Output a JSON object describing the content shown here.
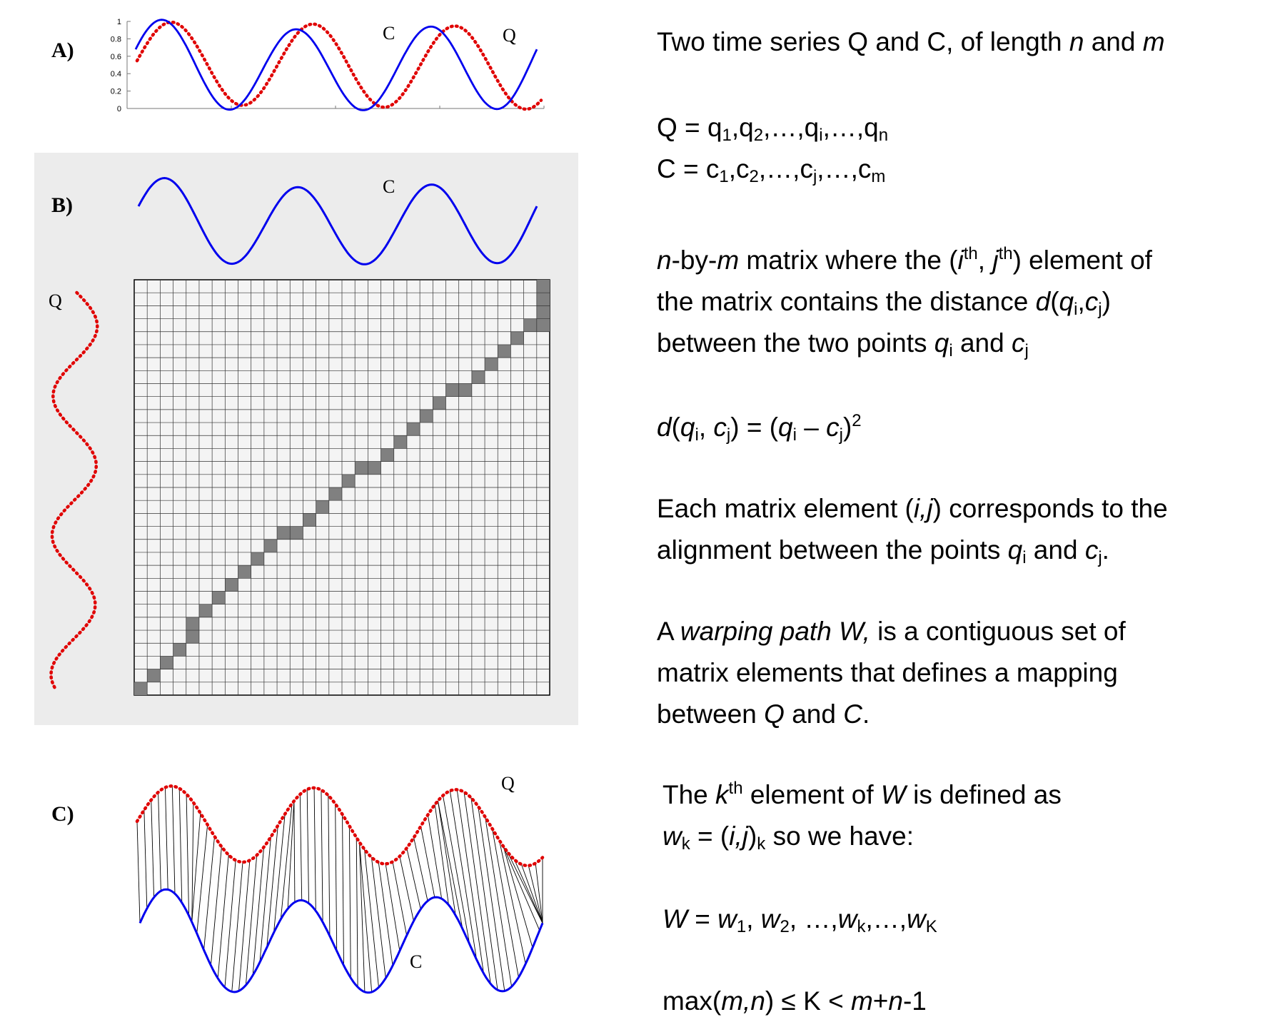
{
  "panels": {
    "a": {
      "label": "A)",
      "series_c_label": "C",
      "series_q_label": "Q",
      "y_ticks": [
        "1",
        "0.8",
        "0.6",
        "0.4",
        "0.2",
        "0"
      ]
    },
    "b": {
      "label": "B)",
      "series_c_label": "C",
      "series_q_label": "Q",
      "grid_size": 32,
      "warping_path": [
        [
          0,
          0
        ],
        [
          1,
          1
        ],
        [
          2,
          2
        ],
        [
          3,
          3
        ],
        [
          4,
          4
        ],
        [
          4,
          5
        ],
        [
          5,
          6
        ],
        [
          6,
          7
        ],
        [
          7,
          8
        ],
        [
          8,
          9
        ],
        [
          9,
          10
        ],
        [
          10,
          11
        ],
        [
          11,
          12
        ],
        [
          12,
          12
        ],
        [
          13,
          13
        ],
        [
          14,
          14
        ],
        [
          15,
          15
        ],
        [
          16,
          16
        ],
        [
          17,
          17
        ],
        [
          18,
          17
        ],
        [
          19,
          18
        ],
        [
          20,
          19
        ],
        [
          21,
          20
        ],
        [
          22,
          21
        ],
        [
          23,
          22
        ],
        [
          24,
          23
        ],
        [
          25,
          23
        ],
        [
          26,
          24
        ],
        [
          27,
          25
        ],
        [
          28,
          26
        ],
        [
          29,
          27
        ],
        [
          30,
          28
        ],
        [
          31,
          28
        ],
        [
          31,
          29
        ],
        [
          31,
          30
        ],
        [
          31,
          31
        ]
      ]
    },
    "c": {
      "label": "C)",
      "series_c_label": "C",
      "series_q_label": "Q"
    }
  },
  "text": {
    "l1": [
      "Two time series Q and C, of length ",
      "n",
      " and ",
      "m"
    ],
    "l2": [
      "Q = q",
      "1",
      ",q",
      "2",
      ",…,q",
      "i",
      ",…,q",
      "n"
    ],
    "l3": [
      "C = c",
      "1",
      ",c",
      "2",
      ",…,c",
      "j",
      ",…,c",
      "m"
    ],
    "l4": [
      "n",
      "-by-",
      "m",
      " matrix where the (",
      "i",
      "th",
      ", ",
      "j",
      "th",
      ") element of"
    ],
    "l5": [
      "the matrix contains the distance ",
      "d",
      "(",
      "q",
      "i",
      ",",
      "c",
      "j",
      ")"
    ],
    "l6": [
      "between the two points ",
      "q",
      "i",
      " and ",
      "c",
      "j"
    ],
    "l7": [
      "d",
      "(",
      "q",
      "i",
      ", ",
      "c",
      "j",
      ") = (",
      "q",
      "i",
      " – ",
      "c",
      "j",
      ")",
      "2"
    ],
    "l8": [
      "Each matrix element (",
      "i,j",
      ") corresponds to the"
    ],
    "l9": [
      "alignment between the points ",
      "q",
      "i",
      " and ",
      "c",
      "j",
      "."
    ],
    "l10": [
      "A ",
      "warping path W,",
      " is a contiguous set of"
    ],
    "l11": [
      "matrix elements that defines a mapping"
    ],
    "l12": [
      "between ",
      "Q",
      " and ",
      "C",
      "."
    ],
    "l13": [
      "The ",
      "k",
      "th",
      " element of ",
      "W",
      " is defined as"
    ],
    "l14": [
      "w",
      "k",
      " = (",
      "i,j",
      ")",
      "k",
      " so we have:"
    ],
    "l15": [
      "W",
      " = ",
      "w",
      "1",
      ", ",
      "w",
      "2",
      ", …,",
      "w",
      "k",
      ",…,",
      "w",
      "K"
    ],
    "l16": [
      "max(",
      "m,n",
      ") ≤ K < ",
      "m",
      "+",
      "n",
      "-1"
    ]
  },
  "colors": {
    "c_series": "#0000ee",
    "q_series": "#e00000",
    "panel_b_background": "#ececec",
    "matrix_cell": "#f4f4f4",
    "path_cell": "#808080"
  }
}
